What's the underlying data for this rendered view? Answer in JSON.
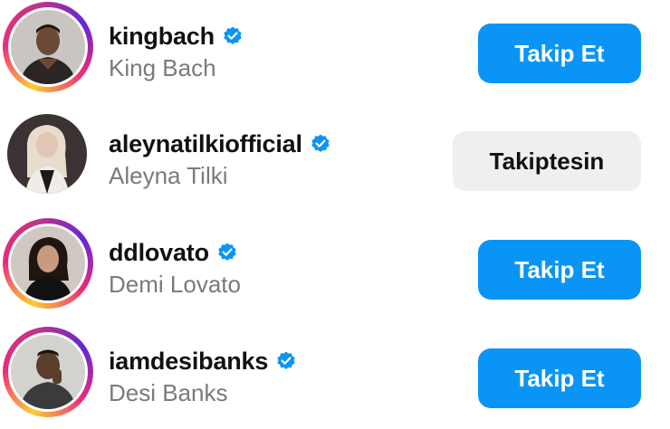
{
  "accounts": [
    {
      "username": "kingbach",
      "full_name": "King Bach",
      "verified": true,
      "has_story_ring": true,
      "button_label": "Takip Et",
      "button_state": "follow"
    },
    {
      "username": "aleynatilkiofficial",
      "full_name": "Aleyna Tilki",
      "verified": true,
      "has_story_ring": false,
      "button_label": "Takiptesin",
      "button_state": "following"
    },
    {
      "username": "ddlovato",
      "full_name": "Demi Lovato",
      "verified": true,
      "has_story_ring": true,
      "button_label": "Takip Et",
      "button_state": "follow"
    },
    {
      "username": "iamdesibanks",
      "full_name": "Desi Banks",
      "verified": true,
      "has_story_ring": true,
      "button_label": "Takip Et",
      "button_state": "follow"
    }
  ],
  "colors": {
    "follow_button": "#0a95f6",
    "following_button": "#efefef",
    "verified_badge": "#0a95f6",
    "username_text": "#111111",
    "fullname_text": "#7a7a7a"
  },
  "icons": {
    "verified": "verified-badge-icon",
    "avatar": "avatar-photo"
  }
}
